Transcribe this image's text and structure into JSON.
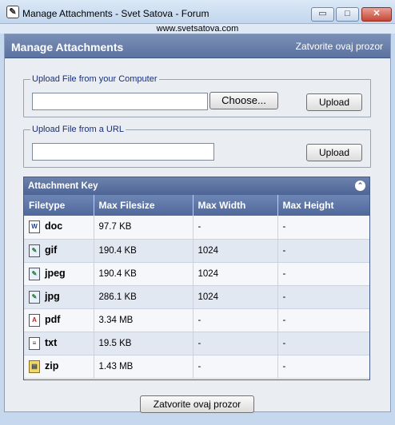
{
  "window": {
    "title": "Manage Attachments - Svet Satova - Forum",
    "url": "www.svetsatova.com",
    "min_glyph": "▭",
    "max_glyph": "□",
    "close_glyph": "✕"
  },
  "header": {
    "title": "Manage Attachments",
    "close_link": "Zatvorite ovaj prozor"
  },
  "upload_computer": {
    "legend": "Upload File from your Computer",
    "choose_label": "Choose...",
    "upload_label": "Upload",
    "file_value": ""
  },
  "upload_url": {
    "legend": "Upload File from a URL",
    "url_value": "",
    "upload_label": "Upload"
  },
  "attachment_key": {
    "title": "Attachment Key",
    "collapse_glyph": "⌃",
    "columns": [
      "Filetype",
      "Max Filesize",
      "Max Width",
      "Max Height"
    ],
    "rows": [
      {
        "type": "doc",
        "icon": "word-document-icon",
        "glyph": "W",
        "size": "97.7 KB",
        "width": "-",
        "height": "-"
      },
      {
        "type": "gif",
        "icon": "image-file-icon",
        "glyph": "✎",
        "size": "190.4 KB",
        "width": "1024",
        "height": "-"
      },
      {
        "type": "jpeg",
        "icon": "image-file-icon",
        "glyph": "✎",
        "size": "190.4 KB",
        "width": "1024",
        "height": "-"
      },
      {
        "type": "jpg",
        "icon": "image-file-icon",
        "glyph": "✎",
        "size": "286.1 KB",
        "width": "1024",
        "height": "-"
      },
      {
        "type": "pdf",
        "icon": "pdf-file-icon",
        "glyph": "A",
        "size": "3.34 MB",
        "width": "-",
        "height": "-"
      },
      {
        "type": "txt",
        "icon": "text-file-icon",
        "glyph": "≡",
        "size": "19.5 KB",
        "width": "-",
        "height": "-"
      },
      {
        "type": "zip",
        "icon": "zip-file-icon",
        "glyph": "▤",
        "size": "1.43 MB",
        "width": "-",
        "height": "-"
      }
    ]
  },
  "footer": {
    "close_label": "Zatvorite ovaj prozor"
  },
  "colors": {
    "header_blue": "#5c73a0",
    "legend_text": "#1a2f76",
    "row_alt": "#e2e8f2"
  }
}
